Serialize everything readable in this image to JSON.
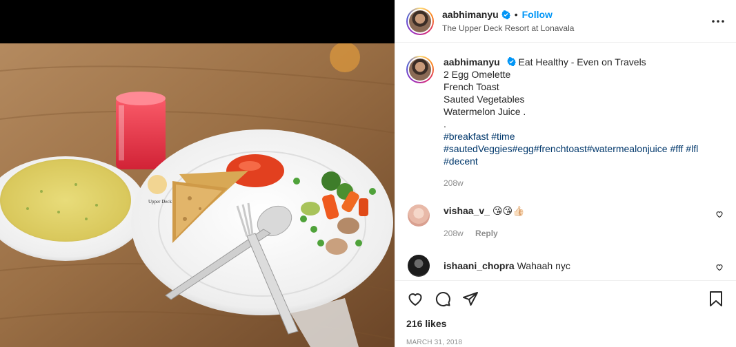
{
  "post": {
    "username": "aabhimanyu",
    "follow_label": "Follow",
    "dot": "•",
    "location": "The Upper Deck Resort at Lonavala",
    "photo_plate_text": "Upper Deck"
  },
  "caption": {
    "username": "aabhimanyu",
    "lines": [
      "Eat Healthy - Even on Travels",
      "2 Egg Omelette",
      "French Toast",
      "Sauted Vegetables",
      "Watermelon Juice .",
      "."
    ],
    "hashtags_line1": "#breakfast #time",
    "hashtags_line2": "#sautedVeggies#egg#frenchtoast#watermealonjuice #fff #lfl",
    "hashtags_line3": "#decent",
    "time": "208w"
  },
  "comments": [
    {
      "username": "vishaa_v_",
      "text": "😘😘👍🏻",
      "time": "208w",
      "reply_label": "Reply"
    },
    {
      "username": "ishaani_chopra",
      "text": "Wahaah nyc"
    }
  ],
  "footer": {
    "likes": "216 likes",
    "date": "MARCH 31, 2018"
  },
  "icons": {
    "verified": "verified-badge-icon",
    "more": "more-options-icon",
    "like": "heart-icon",
    "comment": "comment-icon",
    "share": "share-icon",
    "save": "bookmark-icon"
  },
  "colors": {
    "accent": "#0095f6",
    "hashtag": "#00376b",
    "muted": "#8e8e8e"
  }
}
